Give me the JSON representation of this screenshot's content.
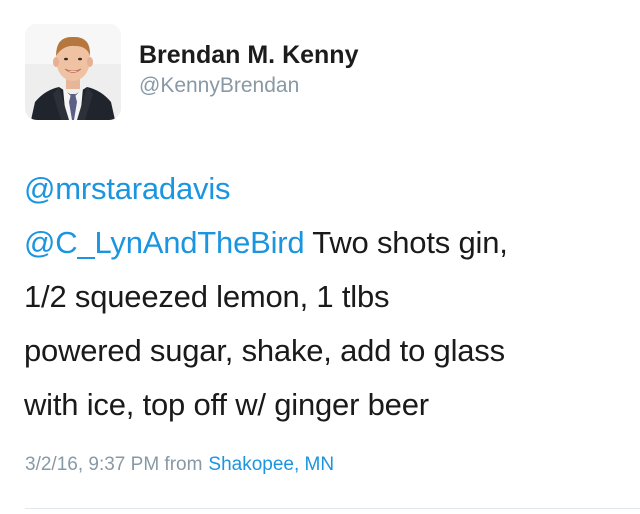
{
  "author": {
    "display_name": "Brendan M. Kenny",
    "handle": "@KennyBrendan"
  },
  "tweet": {
    "mention_1": "@mrstaradavis",
    "mention_2": "@C_LynAndTheBird",
    "line_2_rest": " Two shots gin,",
    "line_3": "1/2 squeezed lemon, 1 tlbs",
    "line_4": "powered sugar, shake, add to glass",
    "line_5": "with ice, top off w/ ginger beer"
  },
  "meta": {
    "timestamp": "3/2/16, 9:37 PM from",
    "location": "Shakopee, MN"
  },
  "colors": {
    "link": "#1b95e0",
    "secondary_text": "#8899a6",
    "primary_text": "#1a1a1a"
  }
}
